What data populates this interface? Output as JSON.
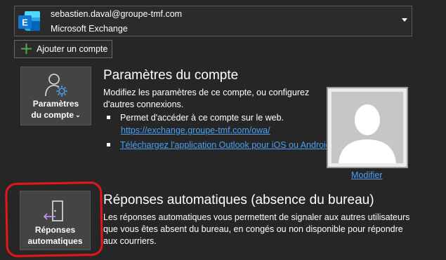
{
  "account": {
    "email": "sebastien.daval@groupe-tmf.com",
    "type": "Microsoft Exchange"
  },
  "add_account": {
    "label": "Ajouter un compte"
  },
  "account_settings": {
    "tile_label_line1": "Paramètres",
    "tile_label_line2": "du compte",
    "title": "Paramètres du compte",
    "description": "Modifiez les paramètres de ce compte, ou configurez d'autres connexions.",
    "bullet_web": "Permet d'accéder à ce compte sur le web.",
    "owa_link": "https://exchange.groupe-tmf.com/owa/",
    "mobile_link": "Téléchargez l'application Outlook pour iOS ou Android.",
    "modify_label": "Modifier"
  },
  "auto_replies": {
    "tile_label_line1": "Réponses",
    "tile_label_line2": "automatiques",
    "title": "Réponses automatiques (absence du bureau)",
    "description": "Les réponses automatiques vous permettent de signaler aux autres utilisateurs que vous êtes absent du bureau, en congés ou non disponible pour répondre aux courriers."
  },
  "colors": {
    "background": "#262626",
    "link": "#4ba0f0",
    "highlight": "#e8141b",
    "exchange_blue": "#0f78d4",
    "add_green": "#4cae4c"
  },
  "icons": {
    "exchange": "exchange-logo-icon",
    "plus": "plus-icon",
    "account_settings": "person-gear-icon",
    "auto_replies": "door-arrow-icon",
    "dropdown": "chevron-down-icon"
  }
}
